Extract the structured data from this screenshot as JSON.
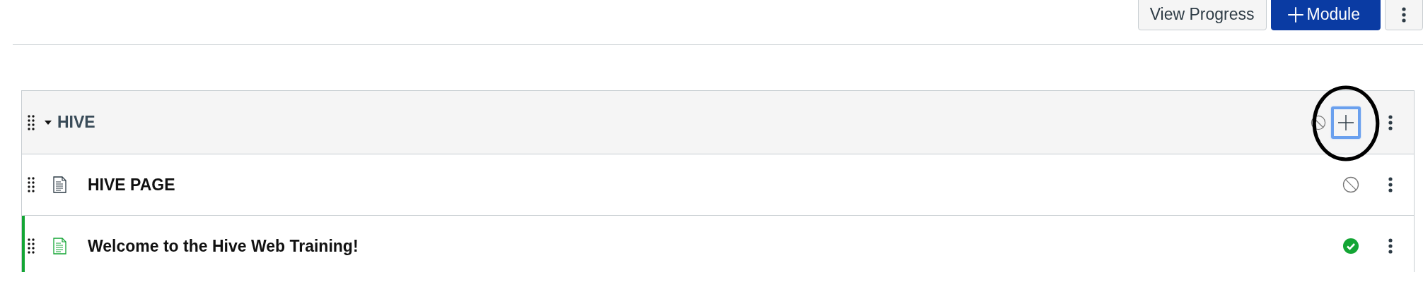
{
  "toolbar": {
    "buttons": [
      {
        "kind": "secondary",
        "label": "View Progress"
      },
      {
        "kind": "add",
        "label": "Module"
      },
      {
        "kind": "menu"
      }
    ]
  },
  "module": {
    "title": "HIVE",
    "expanded": true,
    "published": false,
    "add_button": {
      "focused": true,
      "circled": true
    },
    "items": [
      {
        "kind": "page",
        "title": "HIVE PAGE",
        "published": false
      },
      {
        "kind": "page",
        "title": "Welcome to the Hive Web Training!",
        "published": true
      }
    ]
  }
}
